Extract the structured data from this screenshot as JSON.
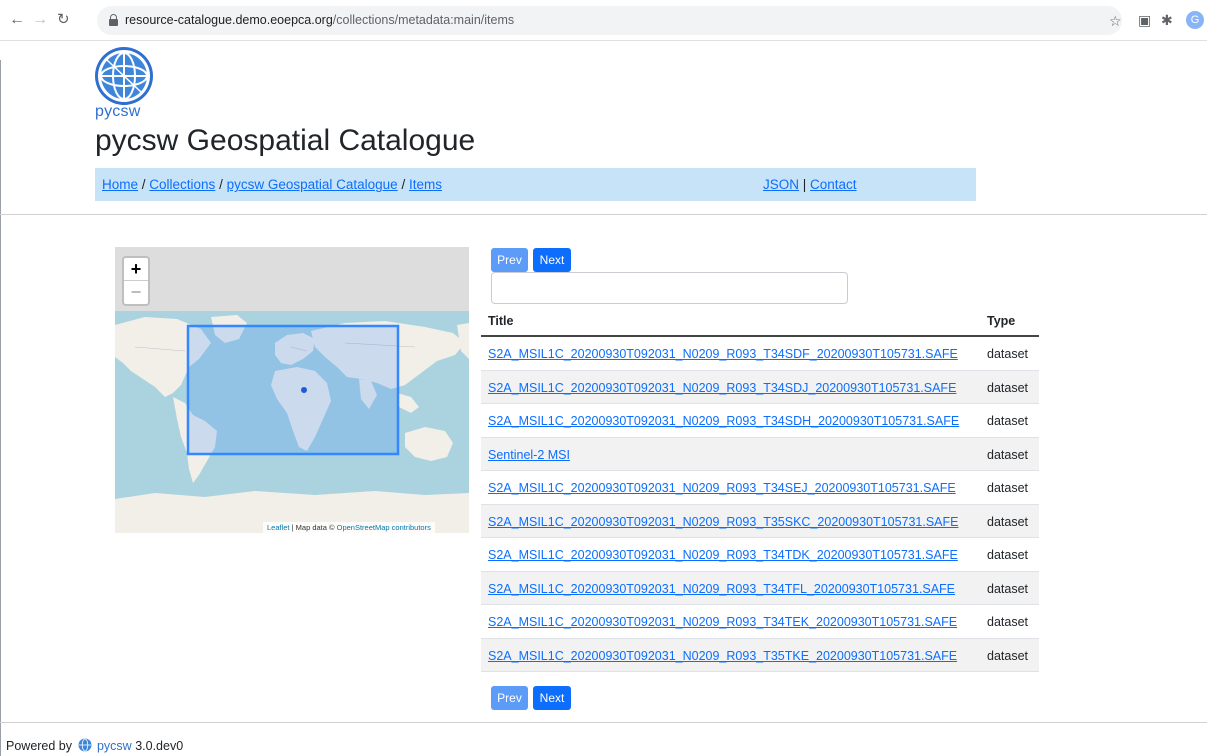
{
  "browser": {
    "url_host": "resource-catalogue.demo.eoepca.org",
    "url_path": "/collections/metadata:main/items",
    "profile_initial": "G"
  },
  "header": {
    "logo_text": "pycsw",
    "title": "pycsw Geospatial Catalogue"
  },
  "breadcrumb": {
    "home": "Home",
    "collections": "Collections",
    "catalogue": "pycsw Geospatial Catalogue",
    "items": "Items",
    "sep": " / "
  },
  "top_links": {
    "json": "JSON",
    "sep": " | ",
    "contact": "Contact"
  },
  "map": {
    "zoom_in": "+",
    "zoom_out": "−",
    "attribution_leaflet": "Leaflet",
    "attribution_sep": " | Map data © ",
    "attribution_osm": "OpenStreetMap contributors"
  },
  "pager": {
    "prev": "Prev",
    "next": "Next",
    "search_value": ""
  },
  "table": {
    "col_title": "Title",
    "col_type": "Type",
    "rows": [
      {
        "title": "S2A_MSIL1C_20200930T092031_N0209_R093_T34SDF_20200930T105731.SAFE",
        "type": "dataset"
      },
      {
        "title": "S2A_MSIL1C_20200930T092031_N0209_R093_T34SDJ_20200930T105731.SAFE",
        "type": "dataset"
      },
      {
        "title": "S2A_MSIL1C_20200930T092031_N0209_R093_T34SDH_20200930T105731.SAFE",
        "type": "dataset"
      },
      {
        "title": "Sentinel-2 MSI",
        "type": "dataset"
      },
      {
        "title": "S2A_MSIL1C_20200930T092031_N0209_R093_T34SEJ_20200930T105731.SAFE",
        "type": "dataset"
      },
      {
        "title": "S2A_MSIL1C_20200930T092031_N0209_R093_T35SKC_20200930T105731.SAFE",
        "type": "dataset"
      },
      {
        "title": "S2A_MSIL1C_20200930T092031_N0209_R093_T34TDK_20200930T105731.SAFE",
        "type": "dataset"
      },
      {
        "title": "S2A_MSIL1C_20200930T092031_N0209_R093_T34TFL_20200930T105731.SAFE",
        "type": "dataset"
      },
      {
        "title": "S2A_MSIL1C_20200930T092031_N0209_R093_T34TEK_20200930T105731.SAFE",
        "type": "dataset"
      },
      {
        "title": "S2A_MSIL1C_20200930T092031_N0209_R093_T35TKE_20200930T105731.SAFE",
        "type": "dataset"
      }
    ]
  },
  "footer": {
    "powered_by": "Powered by",
    "name": "pycsw",
    "version": "3.0.dev0"
  },
  "colors": {
    "link": "#0d6efd",
    "breadcrumb_bg": "#c7e3f7",
    "button_next": "#0d6efd",
    "button_prev": "#5c9cf8",
    "map_water": "#aad3df",
    "map_land": "#f2efe9",
    "bbox": "#3388ff"
  },
  "icons": [
    "back-arrow-icon",
    "forward-arrow-icon",
    "reload-icon",
    "lock-icon",
    "star-icon",
    "extension-icon",
    "puzzle-icon",
    "globe-logo-icon",
    "map-marker-icon"
  ]
}
